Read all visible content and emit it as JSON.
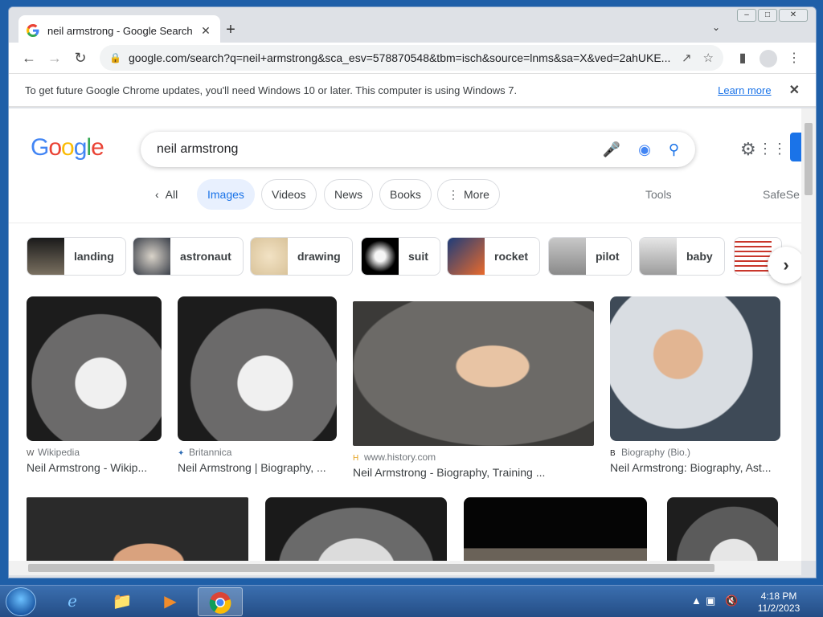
{
  "tab": {
    "title": "neil armstrong - Google Search",
    "close": "✕",
    "new_tab": "+"
  },
  "window_controls": {
    "minimize": "–",
    "maximize": "□",
    "close": "✕"
  },
  "omnibox": {
    "url": "google.com/search?q=neil+armstrong&sca_esv=578870548&tbm=isch&source=lnms&sa=X&ved=2ahUKE..."
  },
  "infobar": {
    "message": "To get future Google Chrome updates, you'll need Windows 10 or later. This computer is using Windows 7.",
    "link": "Learn more"
  },
  "search": {
    "logo": "Google",
    "query": "neil armstrong"
  },
  "filters": {
    "back_label": "All",
    "items": [
      "Images",
      "Videos",
      "News",
      "Books",
      "More"
    ],
    "tools": "Tools",
    "safesearch": "SafeSe"
  },
  "related": [
    "landing",
    "astronaut",
    "drawing",
    "suit",
    "rocket",
    "pilot",
    "baby"
  ],
  "results": [
    {
      "source": "Wikipedia",
      "caption": "Neil Armstrong - Wikip..."
    },
    {
      "source": "Britannica",
      "caption": "Neil Armstrong | Biography, ..."
    },
    {
      "source": "www.history.com",
      "caption": "Neil Armstrong - Biography, Training ..."
    },
    {
      "source": "Biography (Bio.)",
      "caption": "Neil Armstrong: Biography, Ast..."
    }
  ],
  "taskbar": {
    "time": "4:18 PM",
    "date": "11/2/2023"
  },
  "colors": {
    "google_blue": "#4285f4",
    "google_red": "#ea4335",
    "google_yellow": "#fbbc05",
    "google_green": "#34a853",
    "accent": "#1a73e8"
  }
}
